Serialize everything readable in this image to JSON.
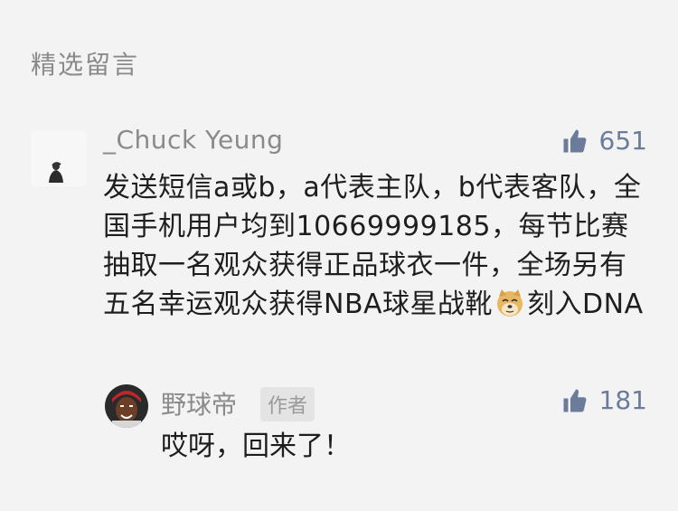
{
  "section": {
    "title": "精选留言"
  },
  "comment": {
    "username": "_Chuck Yeung",
    "likes": "651",
    "text_part1": "发送短信a或b，a代表主队，b代表客队，全国手机用户均到10669999185，每节比赛抽取一名观众获得正品球衣一件，全场另有五名幸运观众获得NBA球星战靴",
    "text_part2": "刻入DNA",
    "emoji": "doge-emoji"
  },
  "reply": {
    "username": "野球帝",
    "badge": "作者",
    "likes": "181",
    "text": "哎呀，回来了！"
  },
  "colors": {
    "background": "#f3f3f3",
    "meta_gray": "#8a8a8a",
    "text": "#1e1e1e",
    "like_blue": "#6b7c9a"
  }
}
